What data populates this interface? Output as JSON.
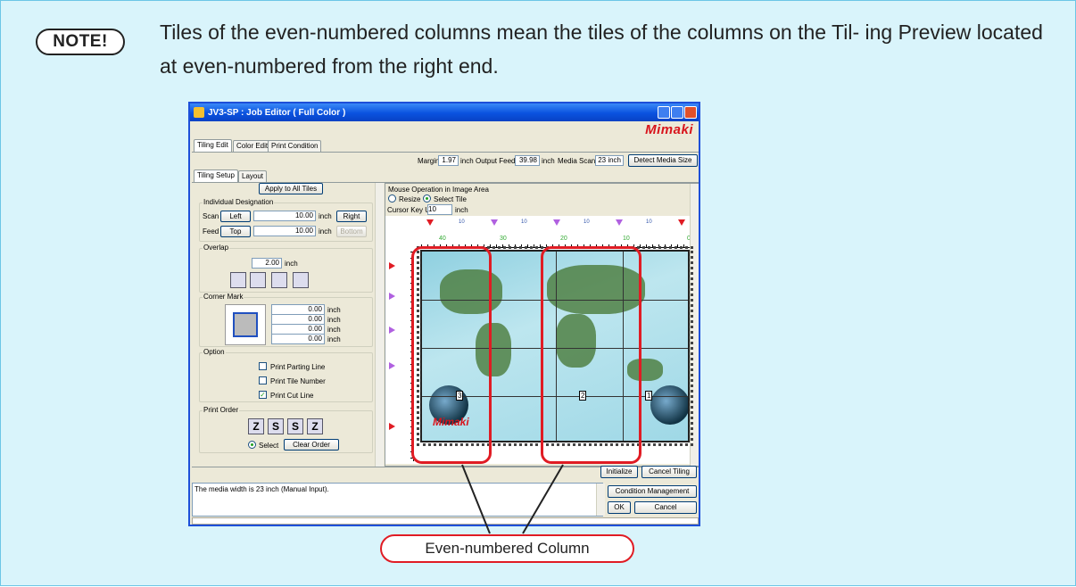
{
  "note": {
    "badge": "NOTE!",
    "text": "Tiles of the even-numbered columns mean the tiles of the columns on the Til- ing Preview located at even-numbered from the right end."
  },
  "window": {
    "title": "JV3-SP : Job Editor ( Full Color )",
    "logo": "Mimaki"
  },
  "tabs": [
    "Tiling Edit",
    "Color Edit",
    "Print Condition"
  ],
  "subtabs": [
    "Tiling Setup",
    "Layout"
  ],
  "top": {
    "margin_label": "Margin",
    "margin_value": "1.97",
    "inch": "inch",
    "output_feed_label": "Output Feed",
    "output_feed_value": "39.98",
    "media_scan_label": "Media  Scan",
    "media_scan_value": "23 inch",
    "detect_button": "Detect Media Size"
  },
  "left": {
    "apply_all": "Apply to All Tiles",
    "individual": {
      "title": "Individual Designation",
      "scan_label": "Scan",
      "left_btn": "Left",
      "scan_value": "10.00",
      "right_btn": "Right",
      "feed_label": "Feed",
      "top_btn": "Top",
      "feed_value": "10.00",
      "bottom_btn": "Bottom",
      "inch": "inch"
    },
    "overlap": {
      "title": "Overlap",
      "value": "2.00",
      "unit": "inch"
    },
    "corner": {
      "title": "Corner Mark",
      "values": [
        "0.00",
        "0.00",
        "0.00",
        "0.00"
      ],
      "unit": "inch"
    },
    "option": {
      "title": "Option",
      "items": [
        "Print Parting Line",
        "Print Tile Number",
        "Print Cut Line"
      ],
      "checked": [
        false,
        false,
        true
      ]
    },
    "order": {
      "title": "Print Order",
      "select": "Select",
      "clear": "Clear Order"
    }
  },
  "preview": {
    "mouse_op": "Mouse Operation in Image Area",
    "resize": "Resize",
    "select_tile": "Select Tile",
    "cursor_key": "Cursor Key Unit",
    "cursor_value": "10",
    "unit": "inch",
    "ruler_top": [
      "10",
      "10",
      "10",
      "10",
      "10"
    ],
    "ruler_nums": [
      "40",
      "30",
      "20",
      "10",
      "0"
    ],
    "tile_nums": [
      "3",
      "2",
      "1"
    ]
  },
  "buttons": {
    "initialize": "Initialize",
    "cancel_tiling": "Cancel Tiling",
    "condition": "Condition Management",
    "ok": "OK",
    "cancel": "Cancel"
  },
  "status": "The media width is 23 inch (Manual Input).",
  "callout": "Even-numbered Column"
}
